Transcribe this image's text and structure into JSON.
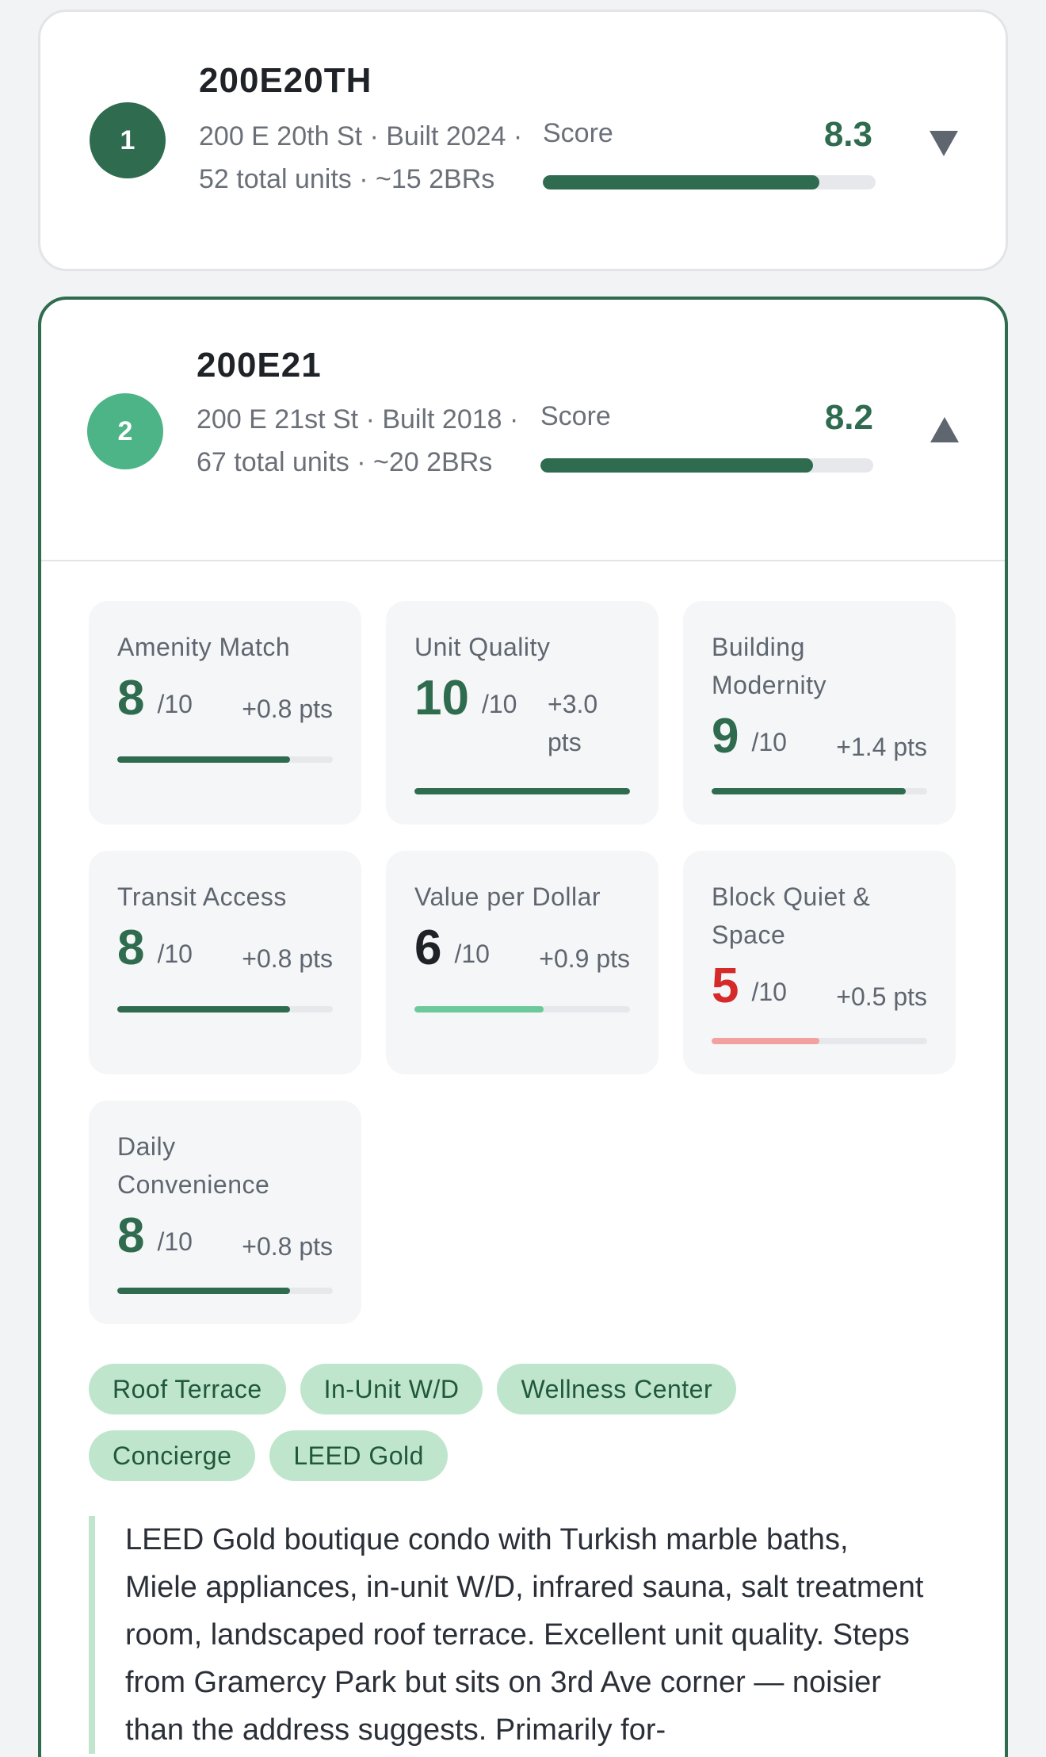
{
  "buildings": [
    {
      "rank": "1",
      "title": "200E20TH",
      "meta": "200 E 20th St · Built 2024 · 52 total units · ~15 2BRs",
      "score_label": "Score",
      "score": "8.3",
      "score_value": 8.3,
      "score_max": 10,
      "expanded": false,
      "badge_color": "#2f6b4f"
    },
    {
      "rank": "2",
      "title": "200E21",
      "meta": "200 E 21st St · Built 2018 · 67 total units · ~20 2BRs",
      "score_label": "Score",
      "score": "8.2",
      "score_value": 8.2,
      "score_max": 10,
      "expanded": true,
      "badge_color": "#4cb486",
      "metrics": [
        {
          "label": "Amenity Match",
          "score": "8",
          "out_of": "/10",
          "pts": "+0.8 pts",
          "value": 8,
          "color": "#2f6b4f"
        },
        {
          "label": "Unit Quality",
          "score": "10",
          "out_of": "/10",
          "pts": "+3.0 pts",
          "value": 10,
          "color": "#2f6b4f"
        },
        {
          "label": "Building Modernity",
          "score": "9",
          "out_of": "/10",
          "pts": "+1.4 pts",
          "value": 9,
          "color": "#2f6b4f"
        },
        {
          "label": "Transit Access",
          "score": "8",
          "out_of": "/10",
          "pts": "+0.8 pts",
          "value": 8,
          "color": "#2f6b4f"
        },
        {
          "label": "Value per Dollar",
          "score": "6",
          "out_of": "/10",
          "pts": "+0.9 pts",
          "value": 6,
          "color": "#1f2328",
          "bar_color": "#6cc99a"
        },
        {
          "label": "Block Quiet & Space",
          "score": "5",
          "out_of": "/10",
          "pts": "+0.5 pts",
          "value": 5,
          "color": "#d42a2a",
          "bar_color": "#f2a0a0"
        },
        {
          "label": "Daily Convenience",
          "score": "8",
          "out_of": "/10",
          "pts": "+0.8 pts",
          "value": 8,
          "color": "#2f6b4f"
        }
      ],
      "tags": [
        "Roof Terrace",
        "In-Unit W/D",
        "Wellness Center",
        "Concierge",
        "LEED Gold"
      ],
      "note": "LEED Gold boutique condo with Turkish marble baths, Miele appliances, in-unit W/D, infrared sauna, salt treatment room, landscaped roof terrace. Excellent unit quality. Steps from Gramercy Park but sits on 3rd Ave corner — noisier than the address suggests. Primarily for-"
    }
  ],
  "icons": {
    "collapsed_toggle": "triangle-down-icon",
    "expanded_toggle": "triangle-up-icon"
  }
}
